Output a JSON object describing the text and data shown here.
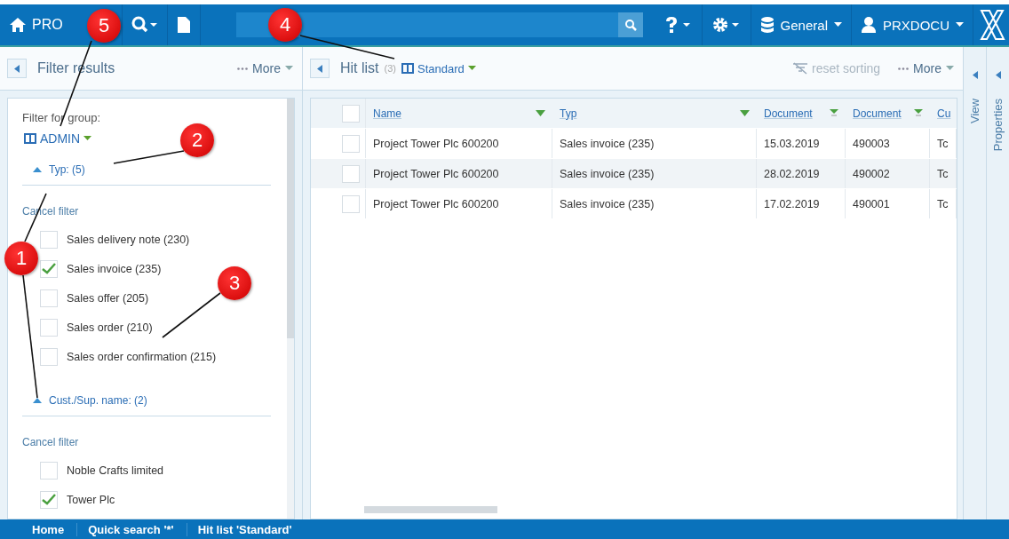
{
  "topbar": {
    "logo": "PRO",
    "menus": [
      {
        "kind": "database",
        "label": "General"
      },
      {
        "kind": "user",
        "label": "PRXDOCU"
      }
    ]
  },
  "filter_panel": {
    "title": "Filter results",
    "more": "More",
    "group_label": "Filter for group:",
    "group": "ADMIN",
    "sections": [
      {
        "title": "Typ: (5)",
        "expanded": true,
        "cancel": "Cancel filter",
        "options": [
          {
            "label": "Sales delivery note (230)",
            "checked": false
          },
          {
            "label": "Sales invoice (235)",
            "checked": true
          },
          {
            "label": "Sales offer (205)",
            "checked": false
          },
          {
            "label": "Sales order (210)",
            "checked": false
          },
          {
            "label": "Sales order confirmation (215)",
            "checked": false
          }
        ]
      },
      {
        "title": "Cust./Sup. name: (2)",
        "expanded": true,
        "cancel": "Cancel filter",
        "options": [
          {
            "label": "Noble Crafts limited",
            "checked": false
          },
          {
            "label": "Tower Plc",
            "checked": true
          }
        ]
      }
    ]
  },
  "hit_list": {
    "select_all_checked": false,
    "title": "Hit list",
    "count": "(3)",
    "view": "Standard",
    "reset": "reset sorting",
    "more": "More",
    "columns": [
      {
        "label": "Name",
        "kind": "filter"
      },
      {
        "label": "Typ",
        "kind": "filter"
      },
      {
        "label": "Document",
        "kind": "sort"
      },
      {
        "label": "Document",
        "kind": "sort"
      },
      {
        "label": "Cu",
        "kind": "plain"
      }
    ],
    "rows": [
      {
        "checked": false,
        "cells": [
          "Project Tower Plc 600200",
          "Sales invoice (235)",
          "15.03.2019",
          "490003",
          "Tc"
        ]
      },
      {
        "checked": false,
        "cells": [
          "Project Tower Plc 600200",
          "Sales invoice (235)",
          "28.02.2019",
          "490002",
          "Tc"
        ]
      },
      {
        "checked": false,
        "cells": [
          "Project Tower Plc 600200",
          "Sales invoice (235)",
          "17.02.2019",
          "490001",
          "Tc"
        ]
      }
    ]
  },
  "side_tabs": [
    "View",
    "Properties"
  ],
  "breadcrumb": [
    "Home",
    "Quick search '*'",
    "Hit list 'Standard'"
  ],
  "callouts": [
    "5",
    "4",
    "2",
    "1",
    "3"
  ]
}
